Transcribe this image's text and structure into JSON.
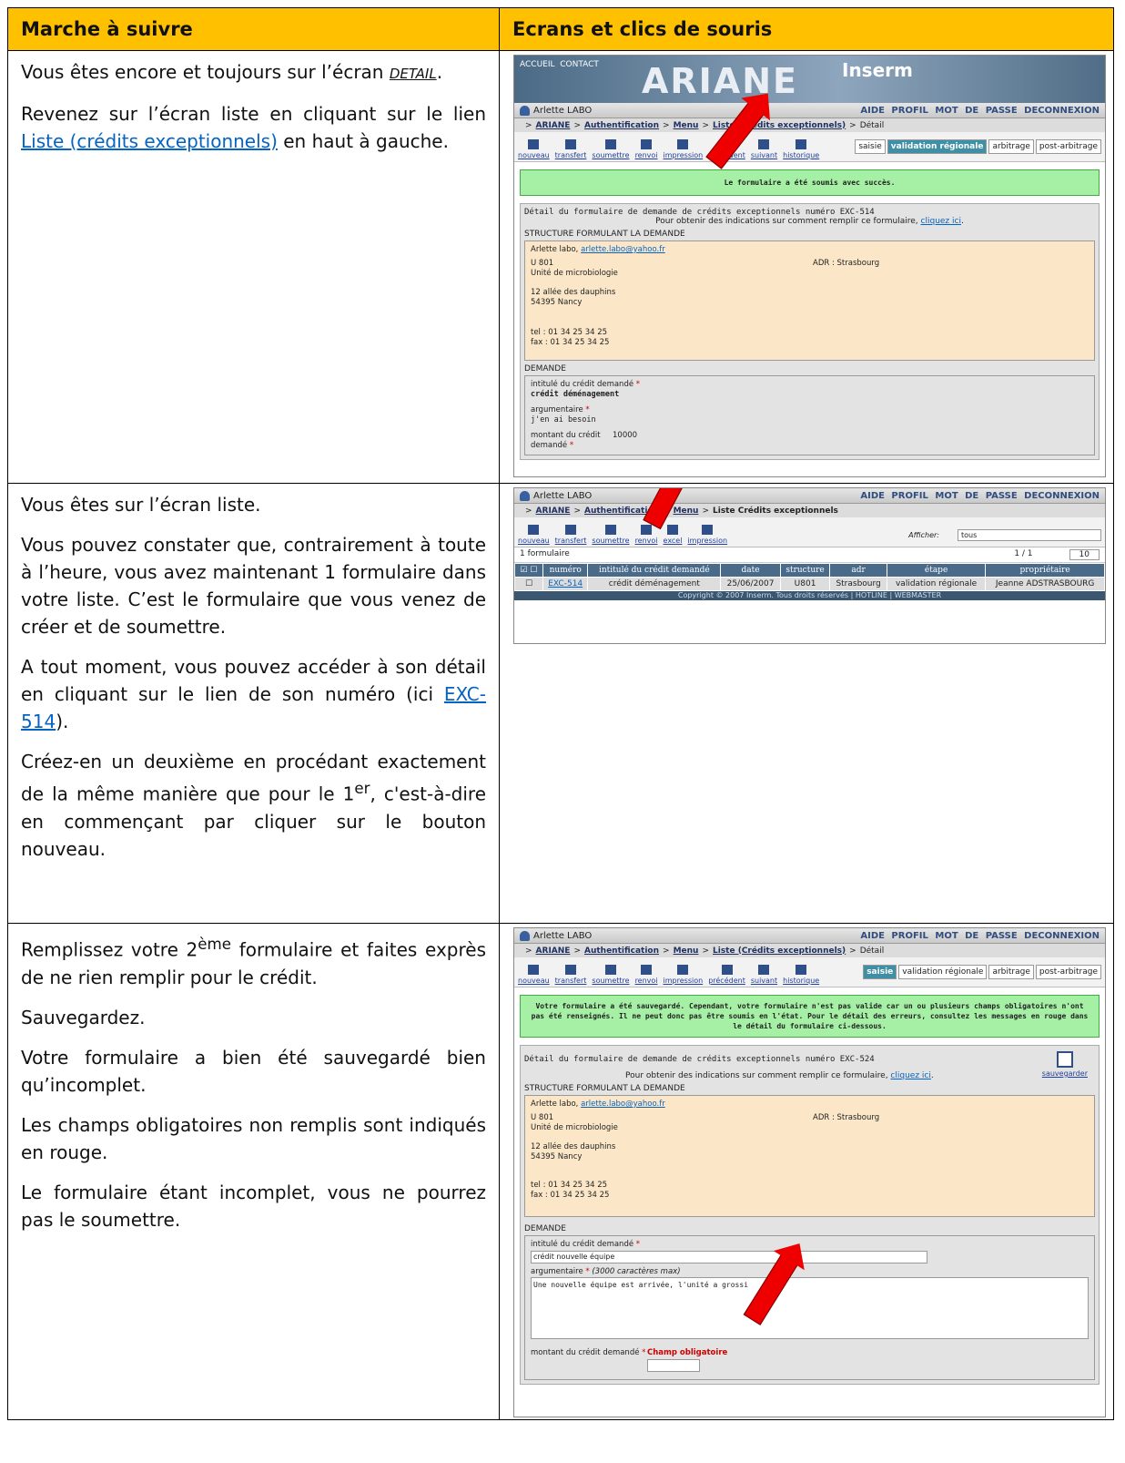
{
  "header": {
    "col1": "Marche à suivre",
    "col2": "Ecrans et clics de souris"
  },
  "rows": [
    {
      "p1_a": "Vous êtes encore et toujours sur l’écran ",
      "p1_b": "DETAIL",
      "p1_c": ".",
      "p2_a": "Revenez sur l’écran liste en cliquant sur le lien ",
      "p2_link": "Liste (crédits exceptionnels)",
      "p2_c": " en haut à gauche."
    },
    {
      "p1": "Vous êtes sur l’écran liste.",
      "p2": "Vous pouvez constater que, contrairement à toute à l’heure, vous avez maintenant 1 formulaire dans votre liste. C’est le formulaire que vous venez de créer et de soumettre.",
      "p3_a": "A tout moment, vous pouvez accéder à son détail en cliquant sur le lien de son numéro (ici ",
      "p3_link": "EXC-514",
      "p3_c": ").",
      "p4_a": "Créez-en un deuxième en procédant exactement de la même manière que pour le 1",
      "p4_sup": "er",
      "p4_c": ", c'est-à-dire en commençant par cliquer sur le bouton nouveau."
    },
    {
      "p1_a": "Remplissez votre 2",
      "p1_sup": "ème",
      "p1_c": " formulaire et faites exprès de ne rien remplir pour le crédit.",
      "p2": "Sauvegardez.",
      "p3": "Votre formulaire a bien été sauvegardé bien qu’incomplet.",
      "p4": "Les champs obligatoires non remplis sont indiqués en rouge.",
      "p5": "Le formulaire étant incomplet, vous ne pourrez pas le soumettre."
    }
  ],
  "app": {
    "nav_accueil": "ACCUEIL",
    "nav_contact": "CONTACT",
    "logo": "ARIANE",
    "inserm": "Inserm",
    "user": "Arlette LABO",
    "top_links": "AIDE PROFIL MOT DE PASSE DECONNEXION",
    "crumb_ariane": "ARIANE",
    "crumb_auth": "Authentification",
    "crumb_menu": "Menu",
    "crumb_liste": "Liste (Crédits exceptionnels)",
    "crumb_liste2": "Liste Crédits exceptionnels",
    "crumb_detail": "Détail",
    "tools1": [
      "nouveau",
      "transfert",
      "soumettre",
      "renvoi",
      "impression",
      "précédent",
      "suivant",
      "historique"
    ],
    "tools2": [
      "nouveau",
      "transfert",
      "soumettre",
      "renvoi",
      "excel",
      "impression"
    ],
    "tabs": [
      "saisie",
      "validation régionale",
      "arbitrage",
      "post-arbitrage"
    ],
    "msg1": "Le formulaire a été soumis avec succès.",
    "msg3": "Votre formulaire a été sauvegardé. Cependant, votre formulaire n'est pas valide car un ou plusieurs champs obligatoires n'ont pas été renseignés. Il ne peut donc pas être soumis en l'état. Pour le détail des erreurs, consultez les messages en rouge dans le détail du formulaire ci-dessous.",
    "detail_title1": "Détail du formulaire de demande de crédits exceptionnels numéro EXC-514",
    "detail_title3": "Détail du formulaire de demande de crédits exceptionnels numéro EXC-524",
    "help": "Pour obtenir des indications sur comment remplir ce formulaire, ",
    "help_link": "cliquez ici",
    "structure_label": "STRUCTURE FORMULANT LA DEMANDE",
    "contact_name": "Arlette labo, ",
    "contact_email": "arlette.labo@yahoo.fr",
    "unit": "U 801",
    "unit_name": "Unité de microbiologie",
    "adr": "ADR : Strasbourg",
    "street": "12 allée des dauphins",
    "city": "54395 Nancy",
    "tel": "tel : 01 34 25 34 25",
    "fax": "fax : 01 34 25 34 25",
    "demande_label": "DEMANDE",
    "intitule_label": "intitulé du crédit demandé",
    "intitule_val1": "crédit déménagement",
    "intitule_val3": "crédit nouvelle équipe",
    "argu_label": "argumentaire",
    "argu_max": "(3000 caractères max)",
    "argu_val1": "j'en ai besoin",
    "argu_val3": "Une nouvelle équipe est arrivée, l'unité a grossi",
    "montant_label": "montant du crédit demandé",
    "montant_val": "10000",
    "champ_obl": "Champ obligatoire",
    "save_label": "sauvegarder",
    "afficher_label": "Afficher:",
    "afficher_val": "tous",
    "count": "1 formulaire",
    "pages": "1 / 1",
    "per_page": "10",
    "cols": [
      "numéro",
      "intitulé du crédit demandé",
      "date",
      "structure",
      "adr",
      "étape",
      "propriétaire"
    ],
    "list_row": [
      "EXC-514",
      "crédit déménagement",
      "25/06/2007",
      "U801",
      "Strasbourg",
      "validation régionale",
      "Jeanne ADSTRASBOURG"
    ],
    "footer": "Copyright © 2007 Inserm. Tous droits réservés | HOTLINE | WEBMASTER"
  }
}
